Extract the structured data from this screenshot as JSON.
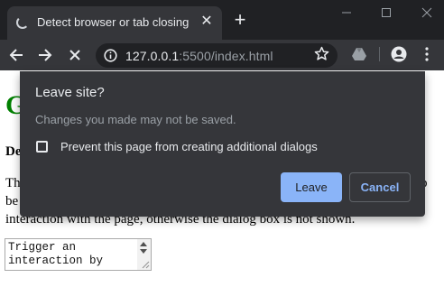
{
  "browser": {
    "tab": {
      "title": "Detect browser or tab closing",
      "close_icon": "close-icon",
      "loading_icon": "spinner-icon"
    },
    "new_tab_icon": "plus-icon",
    "window_controls": [
      "minimize-icon",
      "maximize-icon",
      "close-icon"
    ],
    "address_bar": {
      "url_host": "127.0.0.1",
      "url_rest": ":5500/index.html"
    },
    "toolbar_icons": [
      "back-arrow-icon",
      "forward-arrow-icon",
      "stop-icon",
      "info-icon",
      "star-icon",
      "drive-icon",
      "account-icon",
      "more-vert-icon"
    ],
    "colors": {
      "frame": "#202124",
      "toolbar": "#35363a",
      "text": "#e8eaed",
      "accent": "#8ab4f8"
    }
  },
  "page": {
    "heading": "G",
    "subheading": "De",
    "para_line1": "Thi",
    "para_line1_end": "p",
    "para_line2": "be",
    "para_line3": "interaction with the page, otherwise the dialog box is not shown.",
    "textarea_value": "Trigger an\ninteraction by",
    "heading_color": "#008000"
  },
  "dialog": {
    "title": "Leave site?",
    "message": "Changes you made may not be saved.",
    "checkbox_label": "Prevent this page from creating additional dialogs",
    "checkbox_checked": false,
    "leave_label": "Leave",
    "cancel_label": "Cancel"
  }
}
